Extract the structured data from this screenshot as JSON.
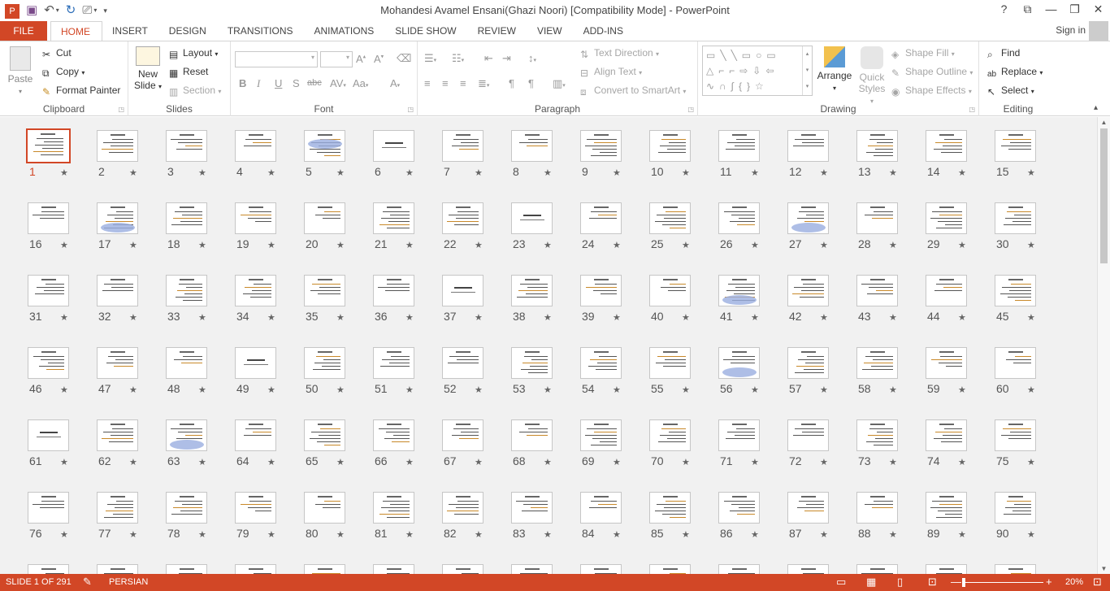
{
  "window": {
    "title": "Mohandesi Avamel Ensani(Ghazi Noori) [Compatibility Mode] - PowerPoint",
    "controls": [
      "?",
      "⧉",
      "—",
      "❐",
      "✕"
    ]
  },
  "qat": {
    "icons": [
      "powerpoint-logo-icon",
      "save-icon",
      "undo-icon",
      "redo-icon",
      "start-from-beginning-icon",
      "customize-qat-icon"
    ]
  },
  "tabs": {
    "file": "FILE",
    "items": [
      "HOME",
      "INSERT",
      "DESIGN",
      "TRANSITIONS",
      "ANIMATIONS",
      "SLIDE SHOW",
      "REVIEW",
      "VIEW",
      "ADD-INS"
    ],
    "active": "HOME",
    "signin": "Sign in"
  },
  "ribbon": {
    "clipboard": {
      "label": "Clipboard",
      "paste": "Paste",
      "cut": "Cut",
      "copy": "Copy",
      "format_painter": "Format Painter"
    },
    "slides": {
      "label": "Slides",
      "new_slide_1": "New",
      "new_slide_2": "Slide",
      "layout": "Layout",
      "reset": "Reset",
      "section": "Section"
    },
    "font": {
      "label": "Font",
      "font_name": "",
      "font_size": "",
      "bold": "B",
      "italic": "I",
      "underline": "U",
      "shadow": "S",
      "strike": "abc"
    },
    "paragraph": {
      "label": "Paragraph",
      "text_direction": "Text Direction",
      "align_text": "Align Text",
      "convert_smartart": "Convert to SmartArt"
    },
    "drawing": {
      "label": "Drawing",
      "arrange": "Arrange",
      "quick_styles_1": "Quick",
      "quick_styles_2": "Styles",
      "shape_fill": "Shape Fill",
      "shape_outline": "Shape Outline",
      "shape_effects": "Shape Effects"
    },
    "editing": {
      "label": "Editing",
      "find": "Find",
      "replace": "Replace",
      "select": "Select"
    }
  },
  "slides": {
    "visible_count": 105,
    "current": 1,
    "per_row": 15,
    "star_glyph": "★",
    "with_images": [
      5,
      17,
      27,
      41,
      56,
      63
    ],
    "title_only": [
      6,
      23,
      37,
      49,
      61
    ]
  },
  "status": {
    "slide_info": "SLIDE 1 OF 291",
    "language": "PERSIAN",
    "zoom": "20%",
    "zoom_fraction": 0.2
  },
  "colors": {
    "accent": "#d24726",
    "sorter_bg": "#f1f1f1"
  }
}
